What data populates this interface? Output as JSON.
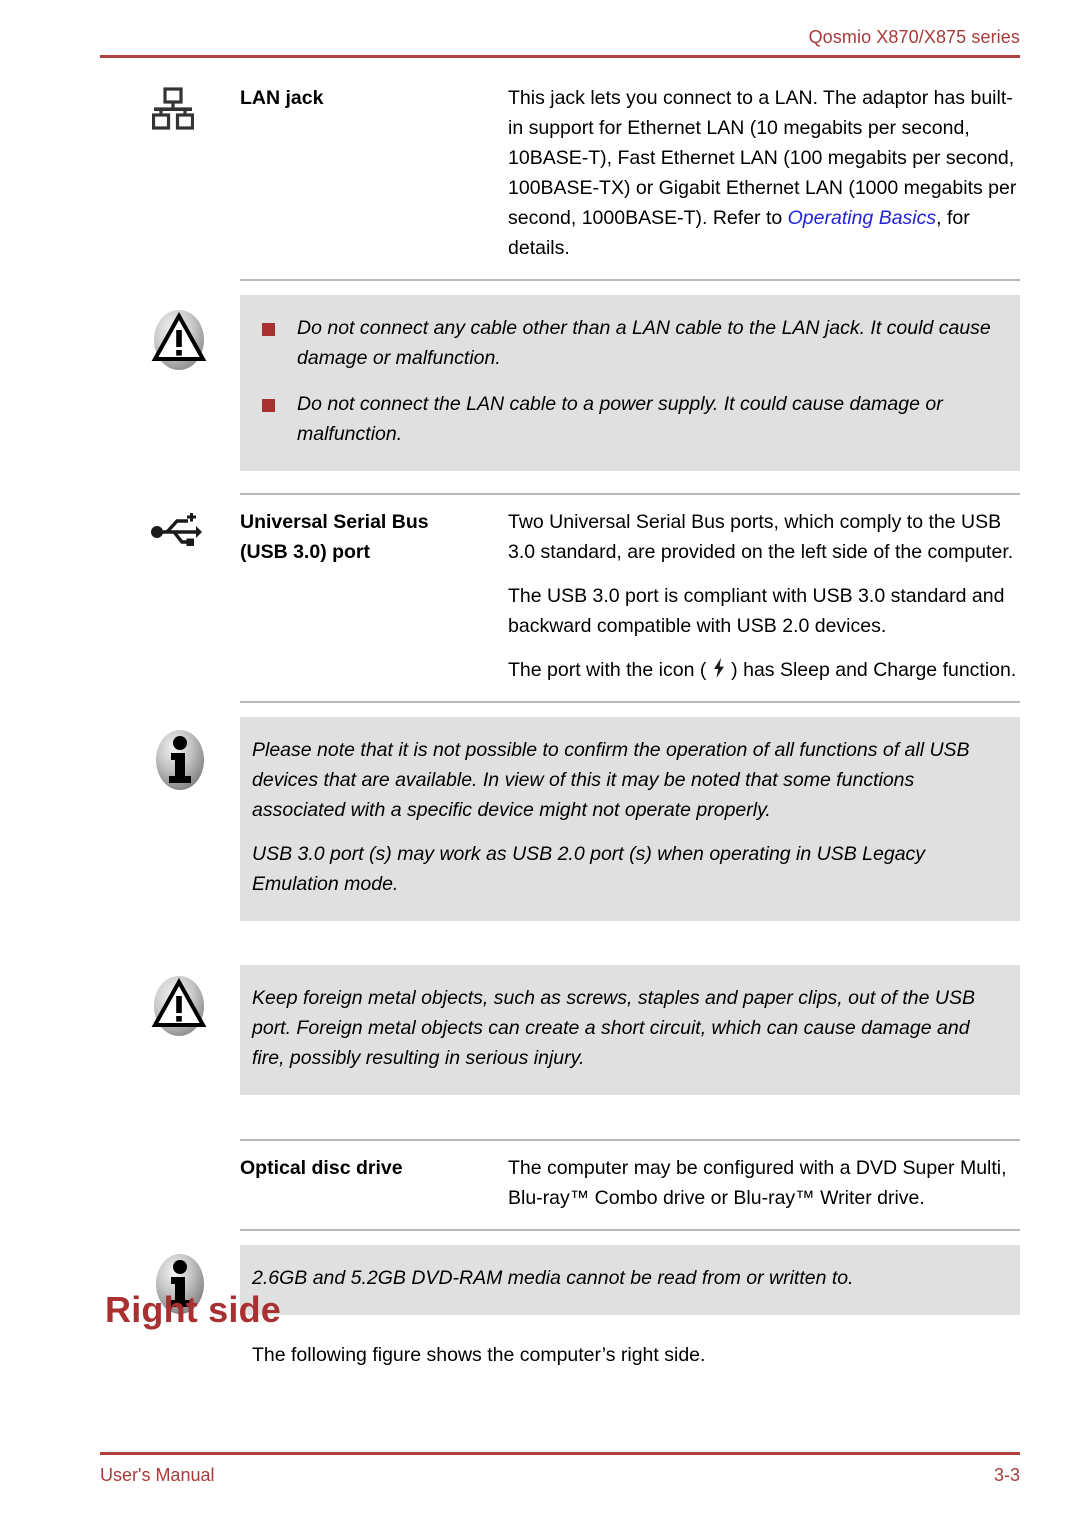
{
  "header": {
    "title": "Qosmio X870/X875 series",
    "rule_color": "#b04040"
  },
  "theme": {
    "accent_red": "#a83a3a",
    "heading_red": "#a83030",
    "bullet_red": "#a93030",
    "link_blue": "#2323d8",
    "note_background": "#e0e0e0",
    "separator_gray": "#b8b8b8"
  },
  "sections": {
    "lan": {
      "icon": "lan-jack-icon",
      "label": "LAN jack",
      "desc_part1": "This jack lets you connect to a LAN. The adaptor has built-in support for Ethernet LAN (10 megabits per second, 10BASE-T), Fast Ethernet LAN (100 megabits per second, 100BASE-TX) or Gigabit Ethernet LAN (1000 megabits per second, 1000BASE-T). Refer to ",
      "desc_link": "Operating Basics",
      "desc_part2": ", for details."
    },
    "lan_caution": {
      "icon": "caution-icon",
      "bullets": [
        "Do not connect any cable other than a LAN cable to the LAN jack. It could cause damage or malfunction.",
        "Do not connect the LAN cable to a power supply. It could cause damage or malfunction."
      ]
    },
    "usb": {
      "icon": "usb-icon",
      "label_line1": "Universal Serial Bus",
      "label_line2": "(USB 3.0) port",
      "paragraphs": [
        "Two Universal Serial Bus ports, which comply to the USB 3.0 standard, are provided on the left side of the computer.",
        "The USB 3.0 port is compliant with USB 3.0 standard and backward compatible with USB 2.0 devices."
      ],
      "sleep_charge_prefix": "The port with the icon ( ",
      "sleep_charge_suffix": " ) has Sleep and Charge function.",
      "inline_icon": "lightning-bolt-icon"
    },
    "usb_note": {
      "icon": "info-icon",
      "paragraphs": [
        "Please note that it is not possible to confirm the operation of all functions of all USB devices that are available. In view of this it may be noted that some functions associated with a specific device might not operate properly.",
        "USB 3.0 port (s) may work as USB 2.0 port (s) when operating in USB Legacy Emulation mode."
      ]
    },
    "usb_caution": {
      "icon": "caution-icon",
      "paragraphs": [
        "Keep foreign metal objects, such as screws, staples and paper clips, out of the USB port. Foreign metal objects can create a short circuit, which can cause damage and fire, possibly resulting in serious injury."
      ]
    },
    "optical": {
      "label": "Optical disc drive",
      "paragraphs": [
        "The computer may be configured with a DVD Super Multi, Blu-ray™ Combo drive or Blu-ray™ Writer drive."
      ]
    },
    "optical_note": {
      "icon": "info-icon",
      "paragraphs": [
        "2.6GB and 5.2GB DVD-RAM media cannot be read from or written to."
      ]
    },
    "right_side": {
      "heading": "Right side",
      "text": "The following figure shows the computer’s right side."
    }
  },
  "footer": {
    "left": "User's Manual",
    "right": "3-3"
  }
}
